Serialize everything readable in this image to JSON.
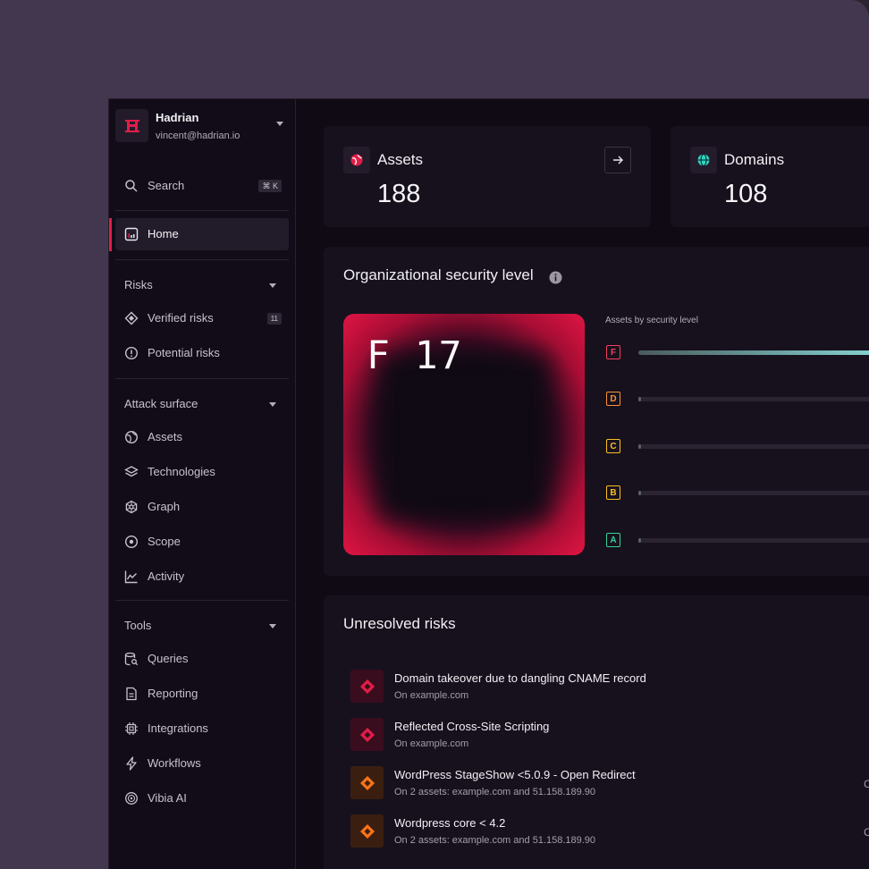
{
  "org": {
    "name": "Hadrian",
    "email": "vincent@hadrian.io",
    "logo_letter": "H"
  },
  "search": {
    "label": "Search",
    "shortcut": "⌘ K"
  },
  "nav": {
    "home": "Home",
    "risks_section": "Risks",
    "verified_risks": "Verified risks",
    "verified_count": "11",
    "potential_risks": "Potential risks",
    "attack_section": "Attack surface",
    "assets": "Assets",
    "technologies": "Technologies",
    "graph": "Graph",
    "scope": "Scope",
    "activity": "Activity",
    "tools_section": "Tools",
    "queries": "Queries",
    "reporting": "Reporting",
    "integrations": "Integrations",
    "workflows": "Workflows",
    "vibia": "Vibia AI"
  },
  "stats": {
    "assets": {
      "title": "Assets",
      "value": "188"
    },
    "domains": {
      "title": "Domains",
      "value": "108"
    }
  },
  "security": {
    "title": "Organizational security level",
    "grade": "F 17",
    "assets_by_label": "Assets by security level",
    "levels": [
      {
        "grade": "F",
        "color": "#f43f5e",
        "fill": 1.0
      },
      {
        "grade": "D",
        "color": "#fb923c",
        "fill": 0.01
      },
      {
        "grade": "C",
        "color": "#fbbf24",
        "fill": 0.01
      },
      {
        "grade": "B",
        "color": "#fbbf24",
        "fill": 0.01
      },
      {
        "grade": "A",
        "color": "#34d399",
        "fill": 0.01
      }
    ]
  },
  "risks": {
    "title": "Unresolved risks",
    "items": [
      {
        "title": "Domain takeover due to dangling CNAME record",
        "sub": "On example.com",
        "severity": "critical"
      },
      {
        "title": "Reflected Cross-Site Scripting",
        "sub": "On example.com",
        "severity": "critical"
      },
      {
        "title": "WordPress StageShow <5.0.9 - Open Redirect",
        "sub": "On 2 assets: example.com and 51.158.189.90",
        "severity": "high"
      },
      {
        "title": "Wordpress core < 4.2",
        "sub": "On 2 assets: example.com and 51.158.189.90",
        "severity": "high"
      }
    ],
    "edge_glyph": "C"
  },
  "colors": {
    "accent": "#e11d48",
    "critical": "#e11d48",
    "high": "#f97316"
  }
}
